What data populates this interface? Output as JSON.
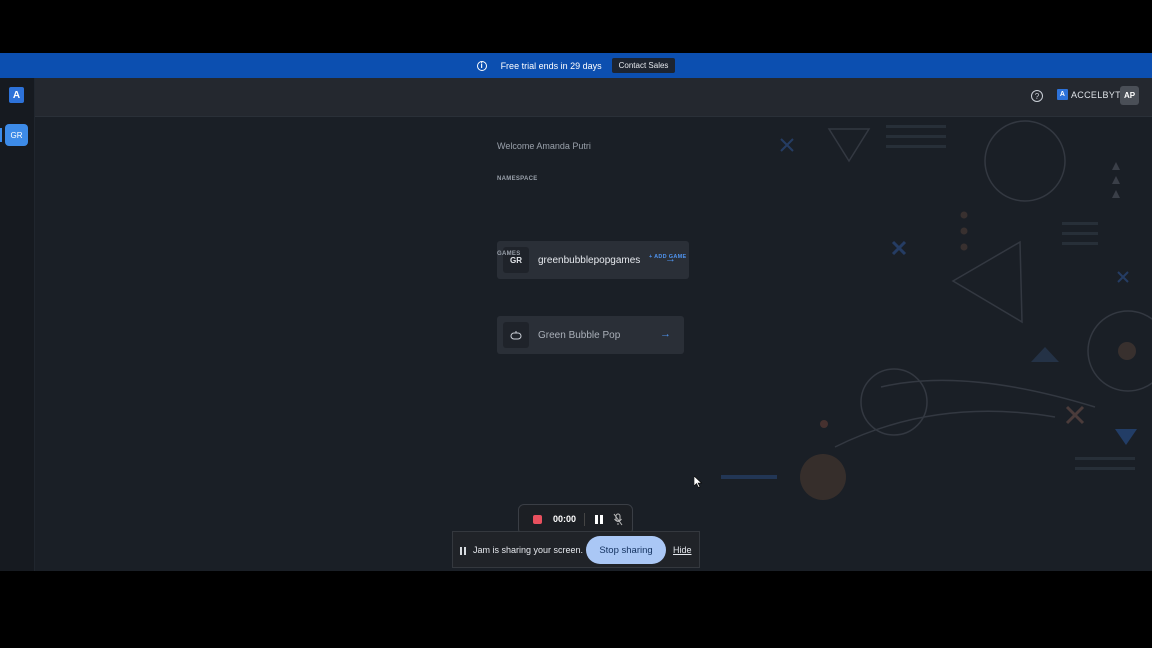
{
  "banner": {
    "text": "Free trial ends in 29 days",
    "contact_label": "Contact Sales"
  },
  "sidebar": {
    "logo": "A",
    "namespace_chip": "GR"
  },
  "header": {
    "help": "?",
    "brand": "ACCELBYTE",
    "brand_mark": "A",
    "avatar": "AP"
  },
  "main": {
    "welcome": "Welcome Amanda Putri",
    "namespace_label": "NAMESPACE",
    "namespace": {
      "badge": "GR",
      "name": "greenbubblepopgames",
      "arrow": "→"
    },
    "games_label": "GAMES",
    "add_game": "+ ADD GAME",
    "games": [
      {
        "name": "Green Bubble Pop",
        "arrow": "→"
      }
    ]
  },
  "recorder": {
    "time": "00:00"
  },
  "share_bar": {
    "text": "Jam is sharing your screen.",
    "stop_label": "Stop sharing",
    "hide_label": "Hide"
  },
  "colors": {
    "accent": "#3d8be8",
    "banner": "#0c4fb0",
    "stop_button": "#aac7f5",
    "record": "#e8505e"
  }
}
